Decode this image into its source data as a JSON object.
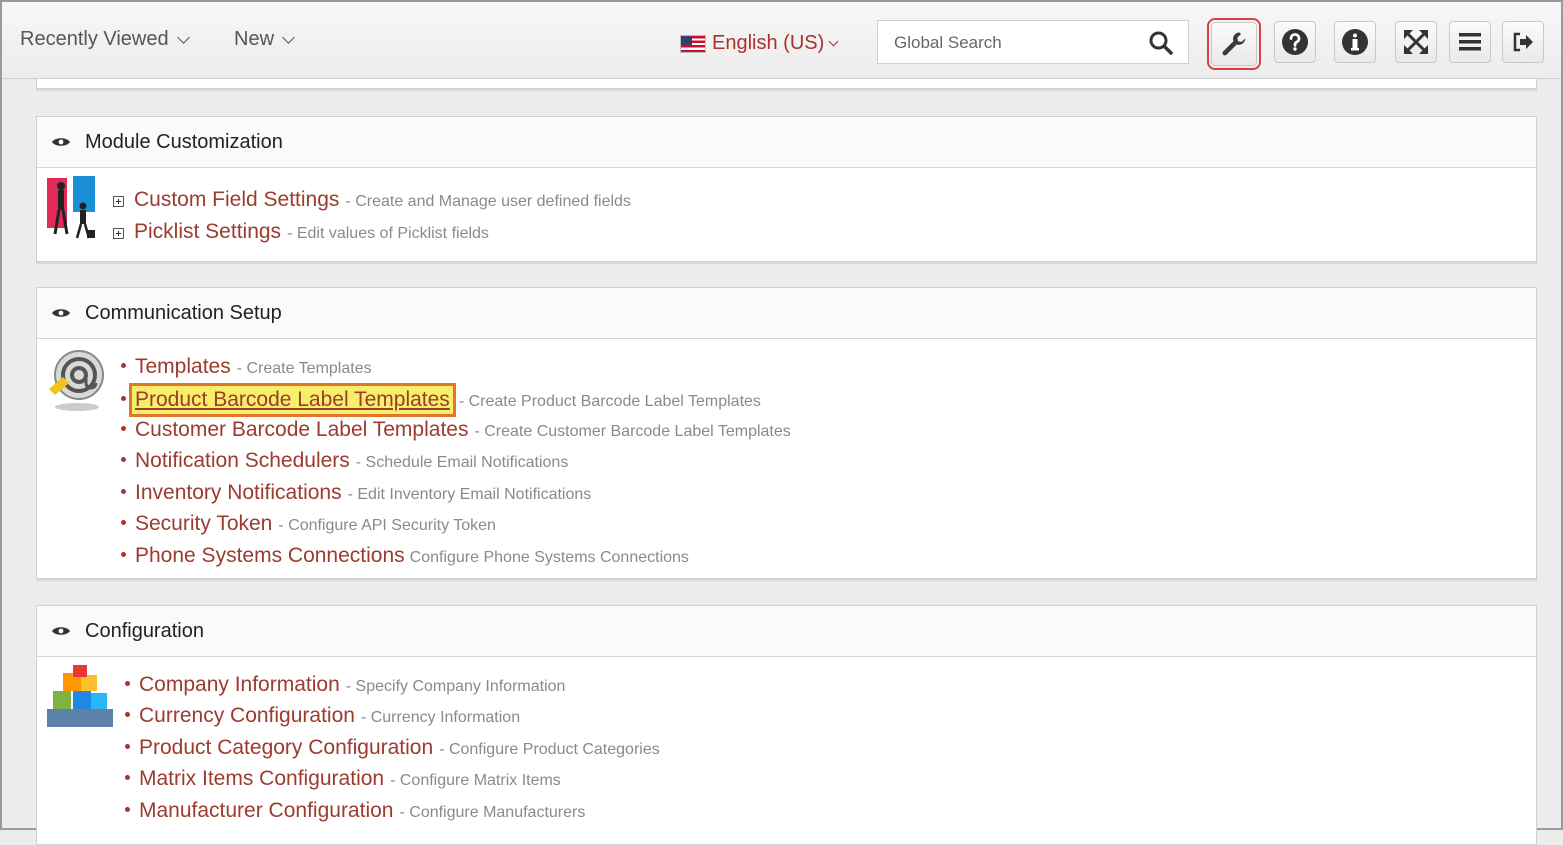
{
  "topbar": {
    "recently_viewed": "Recently Viewed",
    "new": "New",
    "language": "English (US)",
    "search_placeholder": "Global Search"
  },
  "sections": {
    "module": {
      "title": "Module Customization",
      "items": [
        {
          "label": "Custom Field Settings",
          "desc": "- Create and Manage user defined fields"
        },
        {
          "label": "Picklist Settings",
          "desc": "- Edit values of Picklist fields"
        }
      ]
    },
    "communication": {
      "title": "Communication Setup",
      "items": [
        {
          "label": "Templates",
          "desc": "- Create Templates"
        },
        {
          "label": "Product Barcode Label Templates",
          "desc": "- Create Product Barcode Label Templates"
        },
        {
          "label": "Customer Barcode Label Templates",
          "desc": "- Create Customer Barcode Label Templates"
        },
        {
          "label": "Notification Schedulers",
          "desc": "- Schedule Email Notifications"
        },
        {
          "label": "Inventory Notifications",
          "desc": "- Edit Inventory Email Notifications"
        },
        {
          "label": "Security Token",
          "desc": "- Configure API Security Token"
        },
        {
          "label": "Phone Systems Connections",
          "desc": "Configure Phone Systems Connections"
        }
      ]
    },
    "configuration": {
      "title": "Configuration",
      "items": [
        {
          "label": "Company Information",
          "desc": "- Specify Company Information"
        },
        {
          "label": "Currency Configuration",
          "desc": "- Currency Information"
        },
        {
          "label": "Product Category Configuration",
          "desc": "- Configure Product Categories"
        },
        {
          "label": "Matrix Items Configuration",
          "desc": "- Configure Matrix Items"
        },
        {
          "label": "Manufacturer Configuration",
          "desc": "- Configure Manufacturers"
        }
      ]
    }
  },
  "colors": {
    "link": "#9c3b2e",
    "highlight": "#f7ef6a",
    "highlight_border": "#e0762b",
    "active_border": "#d94040"
  },
  "icons": [
    "search-icon",
    "wrench-icon",
    "help-icon",
    "info-icon",
    "fullscreen-icon",
    "menu-icon",
    "logout-icon",
    "eye-icon",
    "flag-us-icon"
  ]
}
